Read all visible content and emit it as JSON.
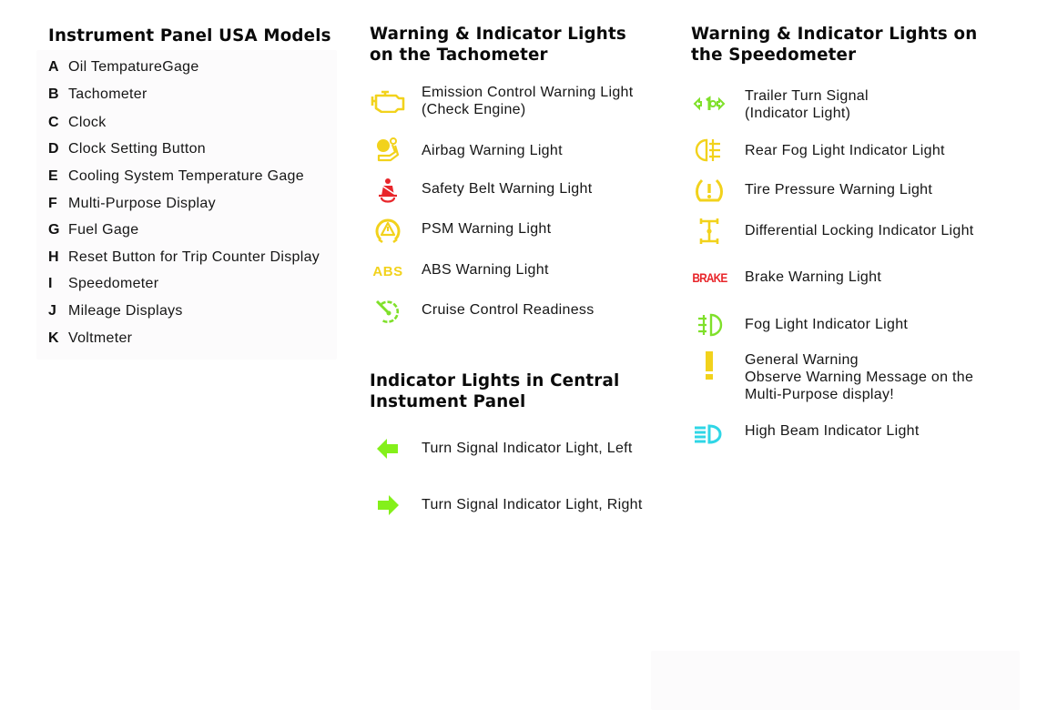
{
  "instrument_panel": {
    "title": "Instrument Panel USA Models",
    "items": [
      {
        "letter": "A",
        "label": "Oil TempatureGage"
      },
      {
        "letter": "B",
        "label": "Tachometer"
      },
      {
        "letter": "C",
        "label": "Clock"
      },
      {
        "letter": "D",
        "label": "Clock Setting Button"
      },
      {
        "letter": "E",
        "label": "Cooling System Temperature Gage"
      },
      {
        "letter": "F",
        "label": "Multi-Purpose Display"
      },
      {
        "letter": "G",
        "label": "Fuel Gage"
      },
      {
        "letter": "H",
        "label": "Reset Button for Trip Counter Display"
      },
      {
        "letter": "I",
        "label": "Speedometer"
      },
      {
        "letter": "J",
        "label": "Mileage Displays"
      },
      {
        "letter": "K",
        "label": "Voltmeter"
      }
    ]
  },
  "tachometer": {
    "title_line1": "Warning & Indicator Lights",
    "title_line2": "on the Tachometer",
    "items": [
      {
        "icon": "check-engine-icon",
        "color": "#f2d21c",
        "line1": "Emission Control Warning Light",
        "line2": "(Check Engine)"
      },
      {
        "icon": "airbag-icon",
        "color": "#f2d21c",
        "line1": "Airbag Warning Light"
      },
      {
        "icon": "seatbelt-icon",
        "color": "#e8262b",
        "line1": "Safety Belt Warning Light"
      },
      {
        "icon": "psm-icon",
        "color": "#f2d21c",
        "line1": "PSM Warning Light"
      },
      {
        "icon": "abs-icon",
        "color": "#f2d21c",
        "glyph": "ABS",
        "line1": "ABS Warning Light"
      },
      {
        "icon": "cruise-control-icon",
        "color": "#7fe02a",
        "line1": "Cruise Control Readiness"
      }
    ]
  },
  "central_panel": {
    "title_line1": "Indicator Lights in Central",
    "title_line2": "Instument Panel",
    "items": [
      {
        "icon": "arrow-left-icon",
        "color": "#84f01a",
        "line1": "Turn Signal Indicator Light, Left"
      },
      {
        "icon": "arrow-right-icon",
        "color": "#84f01a",
        "line1": "Turn Signal Indicator Light, Right"
      }
    ]
  },
  "speedometer": {
    "title_line1": "Warning & Indicator Lights on",
    "title_line2": "the Speedometer",
    "items": [
      {
        "icon": "trailer-turn-signal-icon",
        "color": "#7fe02a",
        "line1": "Trailer Turn Signal",
        "line2": "(Indicator Light)"
      },
      {
        "icon": "rear-fog-light-icon",
        "color": "#f2d21c",
        "line1": "Rear Fog Light Indicator Light"
      },
      {
        "icon": "tire-pressure-icon",
        "color": "#f2d21c",
        "line1": "Tire Pressure Warning Light"
      },
      {
        "icon": "differential-lock-icon",
        "color": "#f2d21c",
        "line1": "Differential Locking Indicator Light"
      },
      {
        "icon": "brake-icon",
        "color": "#e8262b",
        "glyph": "BRAKE",
        "line1": "Brake Warning Light"
      },
      {
        "icon": "fog-light-icon",
        "color": "#7fe02a",
        "line1": "Fog Light Indicator Light"
      },
      {
        "icon": "general-warning-icon",
        "color": "#f2d21c",
        "line1": "General Warning",
        "line2": "Observe Warning Message on the",
        "line3": "Multi-Purpose display!"
      },
      {
        "icon": "high-beam-icon",
        "color": "#2fd6e6",
        "line1": "High Beam Indicator Light"
      }
    ]
  }
}
